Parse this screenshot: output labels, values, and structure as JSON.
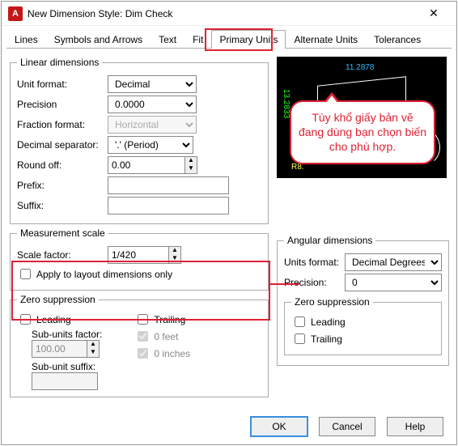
{
  "window": {
    "title": "New Dimension Style: Dim Check",
    "logo_text": "A"
  },
  "tabs": {
    "items": [
      "Lines",
      "Symbols and Arrows",
      "Text",
      "Fit",
      "Primary Units",
      "Alternate Units",
      "Tolerances"
    ],
    "active_index": 4
  },
  "annot": {
    "tooltip": "Tùy khổ giấy bản vẽ đang dùng bạn chọn biến cho phù hợp."
  },
  "linear": {
    "legend": "Linear dimensions",
    "unit_format_label": "Unit format:",
    "unit_format_value": "Decimal",
    "precision_label": "Precision",
    "precision_value": "0.0000",
    "fraction_format_label": "Fraction format:",
    "fraction_format_value": "Horizontal",
    "decimal_separator_label": "Decimal separator:",
    "decimal_separator_value": "'.' (Period)",
    "round_off_label": "Round off:",
    "round_off_value": "0.00",
    "prefix_label": "Prefix:",
    "prefix_value": "",
    "suffix_label": "Suffix:",
    "suffix_value": ""
  },
  "scale": {
    "legend": "Measurement scale",
    "scale_factor_label": "Scale factor:",
    "scale_factor_value": "1/420",
    "apply_layout_label": "Apply to layout dimensions only",
    "apply_layout_checked": false
  },
  "zero_left": {
    "legend": "Zero suppression",
    "leading_label": "Leading",
    "leading_checked": false,
    "trailing_label": "Trailing",
    "trailing_checked": false,
    "subunits_factor_label": "Sub-units factor:",
    "subunits_factor_value": "100.00",
    "subunit_suffix_label": "Sub-unit suffix:",
    "subunit_suffix_value": "",
    "feet_label": "0 feet",
    "feet_checked": true,
    "inches_label": "0 inches",
    "inches_checked": true
  },
  "preview": {
    "dim_top": "11.2878",
    "dim_left": "13.2833",
    "dim_r": "R8."
  },
  "angular": {
    "legend": "Angular dimensions",
    "units_format_label": "Units format:",
    "units_format_value": "Decimal Degrees",
    "precision_label": "Precision:",
    "precision_value": "0"
  },
  "zero_right": {
    "legend": "Zero suppression",
    "leading_label": "Leading",
    "leading_checked": false,
    "trailing_label": "Trailing",
    "trailing_checked": false
  },
  "buttons": {
    "ok": "OK",
    "cancel": "Cancel",
    "help": "Help"
  }
}
